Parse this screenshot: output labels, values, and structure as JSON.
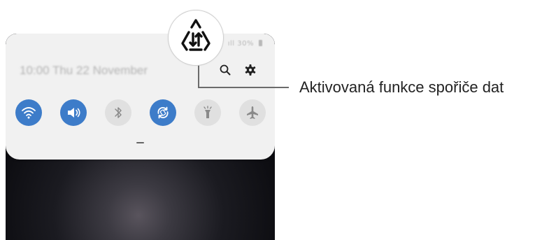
{
  "status_bar": {
    "signal_battery_text": "ıll 30%"
  },
  "quick_panel": {
    "datetime": "10:00  Thu 22 November",
    "header_icons": [
      "search-icon",
      "gear-icon"
    ],
    "tiles": [
      {
        "name": "wifi",
        "icon": "wifi-icon",
        "state": "on"
      },
      {
        "name": "sound",
        "icon": "sound-icon",
        "state": "on"
      },
      {
        "name": "bluetooth",
        "icon": "bluetooth-icon",
        "state": "off"
      },
      {
        "name": "auto-rotate",
        "icon": "auto-rotate-icon",
        "state": "on"
      },
      {
        "name": "flashlight",
        "icon": "flashlight-icon",
        "state": "off"
      },
      {
        "name": "airplane-mode",
        "icon": "airplane-icon",
        "state": "off"
      }
    ]
  },
  "callout": {
    "icon": "data-saver-icon",
    "label": "Aktivovaná funkce spořiče dat"
  },
  "colors": {
    "tile_on": "#3d7cc9",
    "tile_off": "#e0e0e0",
    "panel_bg": "#f1f1f1",
    "callout_line": "#6b6b6b"
  }
}
